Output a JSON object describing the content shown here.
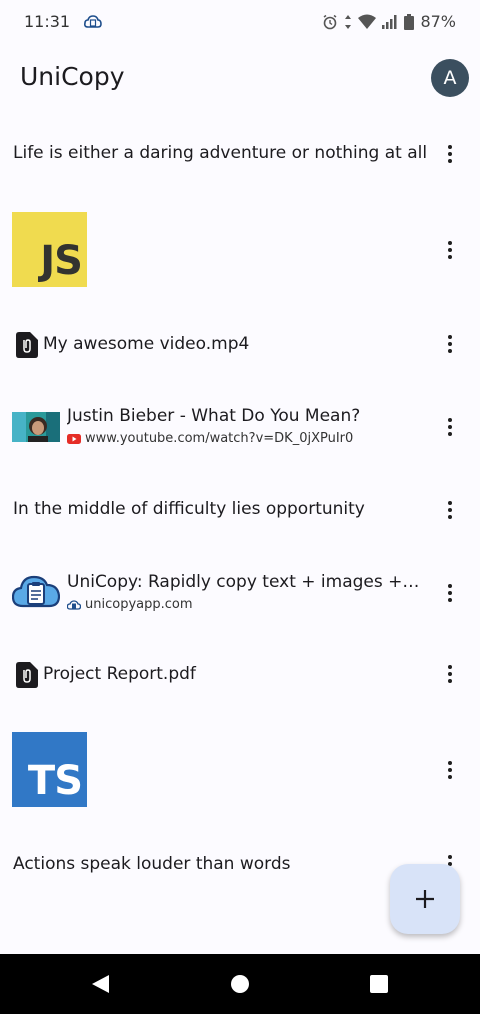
{
  "status_bar": {
    "time": "11:31",
    "battery": "87%"
  },
  "app_bar": {
    "title": "UniCopy",
    "avatar_initial": "A"
  },
  "items": [
    {
      "type": "text",
      "text": "Life is either a daring adventure or nothing at all"
    },
    {
      "type": "image",
      "label": "JS",
      "background": "#f0db4f",
      "text_color": "#323330"
    },
    {
      "type": "file",
      "name": "My awesome video.mp4"
    },
    {
      "type": "link",
      "title": "Justin Bieber - What Do You Mean?",
      "domain": "www.youtube.com/watch?v=DK_0jXPuIr0",
      "favicon": "youtube-icon"
    },
    {
      "type": "text",
      "text": "In the middle of difficulty lies opportunity"
    },
    {
      "type": "link",
      "title": "UniCopy: Rapidly copy text + images + files",
      "domain": "unicopyapp.com",
      "favicon": "unicopy-icon"
    },
    {
      "type": "file",
      "name": "Project Report.pdf"
    },
    {
      "type": "image",
      "label": "TS",
      "background": "#3178c6",
      "text_color": "#ffffff"
    },
    {
      "type": "text",
      "text": "Actions speak louder than words"
    }
  ],
  "fab": {
    "icon": "plus-icon"
  },
  "nav_bar": {
    "icons": [
      "back-icon",
      "home-icon",
      "recents-icon"
    ]
  }
}
